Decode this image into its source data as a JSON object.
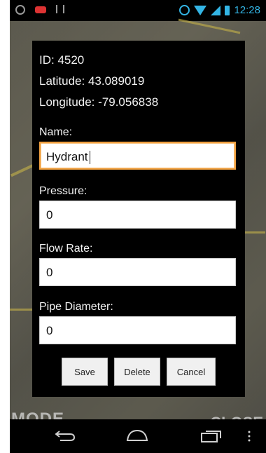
{
  "status_bar": {
    "time": "12:28",
    "icons": [
      "sync-icon",
      "notification-icon",
      "usb-icon",
      "alarm-icon",
      "wifi-icon",
      "signal-icon",
      "battery-icon"
    ]
  },
  "background": {
    "left_label": "MODE",
    "right_label": "CLOSE"
  },
  "dialog": {
    "id_text": "ID: 4520",
    "latitude_text": "Latitude: 43.089019",
    "longitude_text": "Longitude: -79.056838",
    "fields": {
      "name": {
        "label": "Name:",
        "value": "Hydrant"
      },
      "pressure": {
        "label": "Pressure:",
        "value": "0"
      },
      "flow_rate": {
        "label": "Flow Rate:",
        "value": "0"
      },
      "pipe_diameter": {
        "label": "Pipe Diameter:",
        "value": "0"
      }
    },
    "buttons": {
      "save": "Save",
      "delete": "Delete",
      "cancel": "Cancel"
    }
  },
  "colors": {
    "accent": "#33b5e5",
    "focus_border": "#f0a040",
    "dialog_bg": "#000000"
  }
}
